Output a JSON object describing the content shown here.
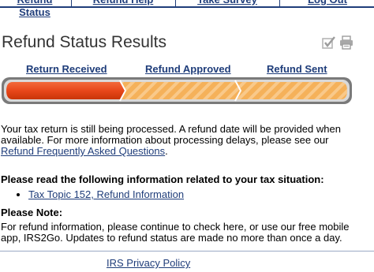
{
  "nav": {
    "items": [
      "Refund Status",
      "Refund Help",
      "Take Survey",
      "Log Out"
    ]
  },
  "page": {
    "title": "Refund Status Results"
  },
  "tools": {
    "icons": [
      "checkmark-edit-icon",
      "printer-icon"
    ]
  },
  "progress": {
    "steps": [
      "Return Received",
      "Refund Approved",
      "Refund Sent"
    ],
    "completed_steps": 1,
    "colors": {
      "active": "#e8471a",
      "inactive": "#f5b15a",
      "track": "#7a7a7a"
    }
  },
  "status": {
    "message": "Your tax return is still being processed. A refund date will be provided when available. For more information about processing delays, please see our ",
    "faq_link": "Refund Frequently Asked Questions",
    "tail": "."
  },
  "tax_situation": {
    "heading": "Please read the following information related to your tax situation:",
    "links": [
      "Tax Topic 152, Refund Information"
    ]
  },
  "note": {
    "heading": "Please Note:",
    "text": "For refund information, please continue to check here, or use our free mobile app, IRS2Go. Updates to refund status are made no more than once a day."
  },
  "footer": {
    "privacy_link": "IRS Privacy Policy"
  }
}
